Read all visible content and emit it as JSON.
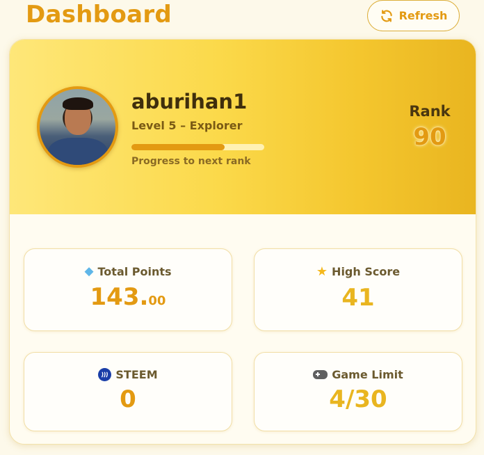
{
  "header": {
    "title": "Dashboard",
    "refresh_label": "Refresh"
  },
  "profile": {
    "username": "aburihan1",
    "level_text": "Level 5 – Explorer",
    "progress_fraction": 0.7,
    "progress_label": "Progress to next rank",
    "rank_label": "Rank",
    "rank_value": "90"
  },
  "stats": {
    "total_points": {
      "title": "Total Points",
      "value_int": "143.",
      "value_dec": "00",
      "icon": "gem-icon"
    },
    "high_score": {
      "title": "High Score",
      "value": "41",
      "icon": "star-icon"
    },
    "steem": {
      "title": "STEEM",
      "value": "0",
      "icon": "steem-icon"
    },
    "game_limit": {
      "title": "Game Limit",
      "value": "4/30",
      "icon": "gamepad-icon"
    }
  },
  "colors": {
    "accent": "#e39a12",
    "hero_start": "#fee779",
    "hero_end": "#e9b520",
    "high_score_color": "#e9b520"
  }
}
